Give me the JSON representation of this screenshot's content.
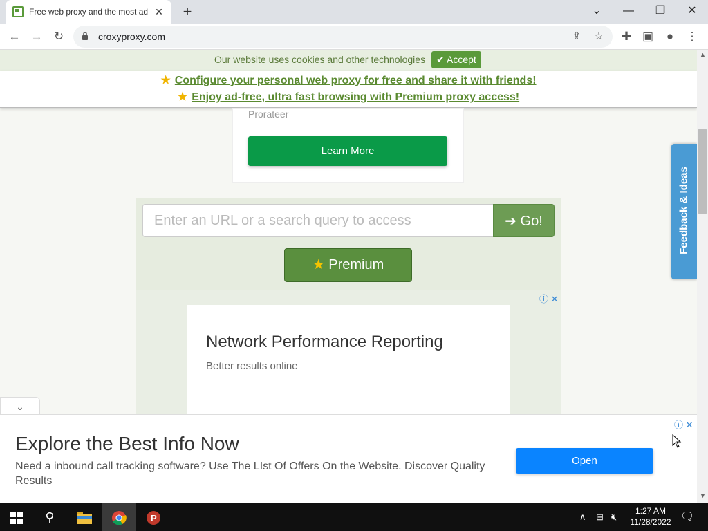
{
  "browser": {
    "tab_title": "Free web proxy and the most ad",
    "url": "croxyproxy.com",
    "window_controls": {
      "minimize": "—",
      "maximize": "❐",
      "close": "✕"
    }
  },
  "cookie_bar": {
    "text": "Our website uses cookies and other technologies",
    "accept_label": "Accept"
  },
  "promo": {
    "line1": "Configure your personal web proxy for free and share it with friends!",
    "line2": "Enjoy ad-free, ultra fast browsing with Premium proxy access!"
  },
  "top_ad": {
    "brand": "Prorateer",
    "button": "Learn More"
  },
  "proxy_form": {
    "placeholder": "Enter an URL or a search query to access",
    "go_label": "Go!",
    "premium_label": "Premium"
  },
  "mid_ad": {
    "headline": "Network Performance Reporting",
    "subline": "Better results online"
  },
  "bottom_ad": {
    "headline": "Explore the Best Info Now",
    "description": "Need a inbound call tracking software? Use The LIst Of Offers On the Website. Discover Quality Results",
    "button": "Open"
  },
  "feedback_tab": "Feedback & Ideas",
  "taskbar": {
    "time": "1:27 AM",
    "date": "11/28/2022"
  }
}
